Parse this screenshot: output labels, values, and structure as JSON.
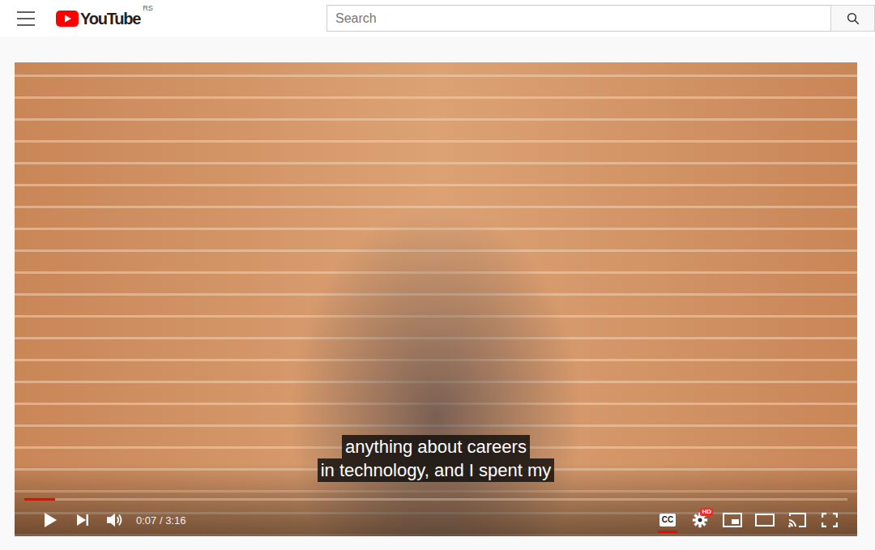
{
  "header": {
    "logo": {
      "text": "YouTube",
      "region": "RS"
    },
    "search": {
      "placeholder": "Search"
    }
  },
  "player": {
    "paused": true,
    "captions_lines": [
      "anything about careers",
      "in technology, and I spent my"
    ],
    "progress": {
      "level": 0.037
    },
    "time": "0:07 / 3:16",
    "cc": {
      "label": "CC",
      "on": true
    },
    "settings": {
      "badge": "HD"
    }
  }
}
